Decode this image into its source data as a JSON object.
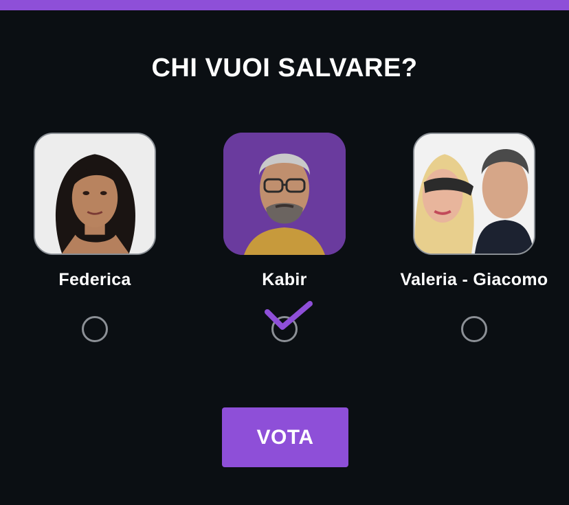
{
  "poll": {
    "title": "CHI VUOI SALVARE?",
    "candidates": [
      {
        "name": "Federica",
        "selected": false
      },
      {
        "name": "Kabir",
        "selected": true
      },
      {
        "name": "Valeria - Giacomo",
        "selected": false
      }
    ],
    "vote_label": "VOTA"
  },
  "colors": {
    "accent": "#8e4fd8",
    "background": "#0b0f13",
    "photo_purple": "#6a3b9e",
    "radio_border": "#8c9096"
  }
}
